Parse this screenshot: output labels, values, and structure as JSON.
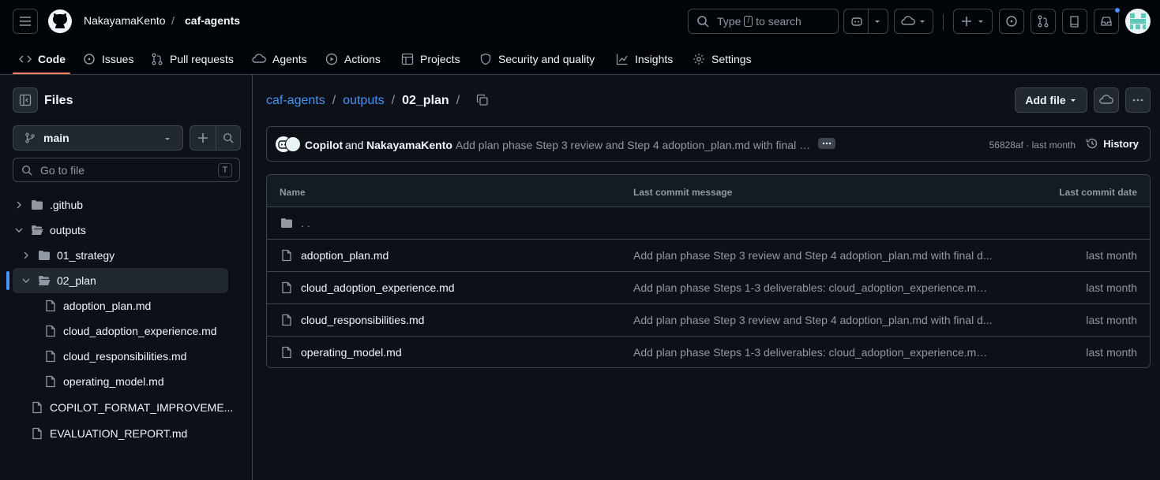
{
  "header": {
    "owner": "NakayamaKento",
    "separator": "/",
    "repo": "caf-agents",
    "search_prefix": "Type",
    "search_key": "/",
    "search_suffix": "to search"
  },
  "tabs": [
    {
      "label": "Code",
      "icon": "code-icon"
    },
    {
      "label": "Issues",
      "icon": "issue-icon"
    },
    {
      "label": "Pull requests",
      "icon": "pull-request-icon"
    },
    {
      "label": "Agents",
      "icon": "agents-icon"
    },
    {
      "label": "Actions",
      "icon": "play-icon"
    },
    {
      "label": "Projects",
      "icon": "table-icon"
    },
    {
      "label": "Security and quality",
      "icon": "shield-icon"
    },
    {
      "label": "Insights",
      "icon": "graph-icon"
    },
    {
      "label": "Settings",
      "icon": "gear-icon"
    }
  ],
  "sidebar": {
    "title": "Files",
    "branch": "main",
    "goto_placeholder": "Go to file",
    "goto_key": "T",
    "tree": [
      {
        "label": ".github",
        "type": "folder"
      },
      {
        "label": "outputs",
        "type": "folder"
      },
      {
        "label": "01_strategy",
        "type": "folder"
      },
      {
        "label": "02_plan",
        "type": "folder"
      },
      {
        "label": "adoption_plan.md",
        "type": "file"
      },
      {
        "label": "cloud_adoption_experience.md",
        "type": "file"
      },
      {
        "label": "cloud_responsibilities.md",
        "type": "file"
      },
      {
        "label": "operating_model.md",
        "type": "file"
      },
      {
        "label": "COPILOT_FORMAT_IMPROVEME...",
        "type": "file"
      },
      {
        "label": "EVALUATION_REPORT.md",
        "type": "file"
      }
    ]
  },
  "breadcrumb": {
    "repo": "caf-agents",
    "folder": "outputs",
    "current": "02_plan",
    "sep": "/"
  },
  "add_file_label": "Add file",
  "commit": {
    "author1": "Copilot",
    "and": "and",
    "author2": "NakayamaKento",
    "message": "Add plan phase Step 3 review and Step 4 adoption_plan.md with final d...",
    "sha_time": "56828af · last month",
    "history_label": "History"
  },
  "table": {
    "col_name": "Name",
    "col_message": "Last commit message",
    "col_date": "Last commit date",
    "parent": ". .",
    "rows": [
      {
        "name": "adoption_plan.md",
        "message": "Add plan phase Step 3 review and Step 4 adoption_plan.md with final d...",
        "date": "last month"
      },
      {
        "name": "cloud_adoption_experience.md",
        "message": "Add plan phase Steps 1-3 deliverables: cloud_adoption_experience.md, ...",
        "date": "last month"
      },
      {
        "name": "cloud_responsibilities.md",
        "message": "Add plan phase Step 3 review and Step 4 adoption_plan.md with final d...",
        "date": "last month"
      },
      {
        "name": "operating_model.md",
        "message": "Add plan phase Steps 1-3 deliverables: cloud_adoption_experience.md, ...",
        "date": "last month"
      }
    ]
  },
  "colors": {
    "accent": "#4493f8",
    "underline": "#f78166",
    "bg": "#0d1117",
    "header_bg": "#010409"
  }
}
